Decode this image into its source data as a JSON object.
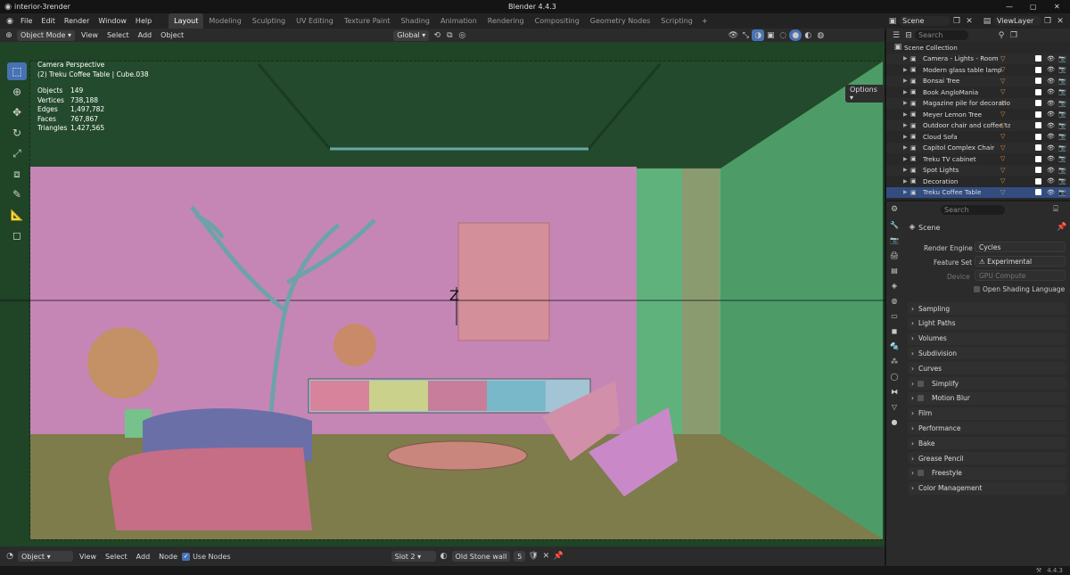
{
  "window": {
    "title": "interior-3render",
    "app_title": "Blender 4.4.3"
  },
  "menu": [
    "File",
    "Edit",
    "Render",
    "Window",
    "Help"
  ],
  "workspaces": [
    "Layout",
    "Modeling",
    "Sculpting",
    "UV Editing",
    "Texture Paint",
    "Shading",
    "Animation",
    "Rendering",
    "Compositing",
    "Geometry Nodes",
    "Scripting"
  ],
  "active_workspace": "Layout",
  "scene": {
    "scene_name": "Scene",
    "view_layer": "ViewLayer"
  },
  "viewport_header": {
    "mode": "Object Mode",
    "menus": [
      "View",
      "Select",
      "Add",
      "Object"
    ],
    "transform": "Global",
    "options": "Options"
  },
  "viewport": {
    "perspective": "Camera Perspective",
    "active": "(2) Treku Coffee Table | Cube.038",
    "stats": [
      {
        "k": "Objects",
        "v": "149"
      },
      {
        "k": "Vertices",
        "v": "738,188"
      },
      {
        "k": "Edges",
        "v": "1,497,782"
      },
      {
        "k": "Faces",
        "v": "767,867"
      },
      {
        "k": "Triangles",
        "v": "1,427,565"
      }
    ]
  },
  "outliner": {
    "search_placeholder": "Search",
    "root": "Scene Collection",
    "items": [
      "Camera - Lights - Room",
      "Modern glass table lamp",
      "Bonsai Tree",
      "Book AngloMania",
      "Magazine pile for decoration",
      "Meyer Lemon Tree",
      "Outdoor chair and coffee table",
      "Cloud Sofa",
      "Capitol Complex Chair",
      "Treku TV cabinet",
      "Spot Lights",
      "Decoration",
      "Treku Coffee Table"
    ],
    "selected": "Treku Coffee Table"
  },
  "properties": {
    "search_placeholder": "Search",
    "scene": "Scene",
    "render_engine_label": "Render Engine",
    "render_engine": "Cycles",
    "feature_set_label": "Feature Set",
    "feature_set": "Experimental",
    "device_label": "Device",
    "device": "GPU Compute",
    "osl": "Open Shading Language",
    "panels": [
      "Sampling",
      "Light Paths",
      "Volumes",
      "Subdivision",
      "Curves",
      "Simplify",
      "Motion Blur",
      "Film",
      "Performance",
      "Bake",
      "Grease Pencil",
      "Freestyle",
      "Color Management"
    ]
  },
  "node_header": {
    "editor": "Object",
    "menus": [
      "View",
      "Select",
      "Add",
      "Node"
    ],
    "use_nodes": "Use Nodes",
    "slot": "Slot 2",
    "material": "Old Stone wall",
    "users": "5"
  },
  "status": {
    "version": "4.4.3"
  },
  "colors": {
    "accent": "#4772b3",
    "wall": "#c987b8",
    "floor": "#7d7c4a",
    "room": "#2a5a34"
  }
}
